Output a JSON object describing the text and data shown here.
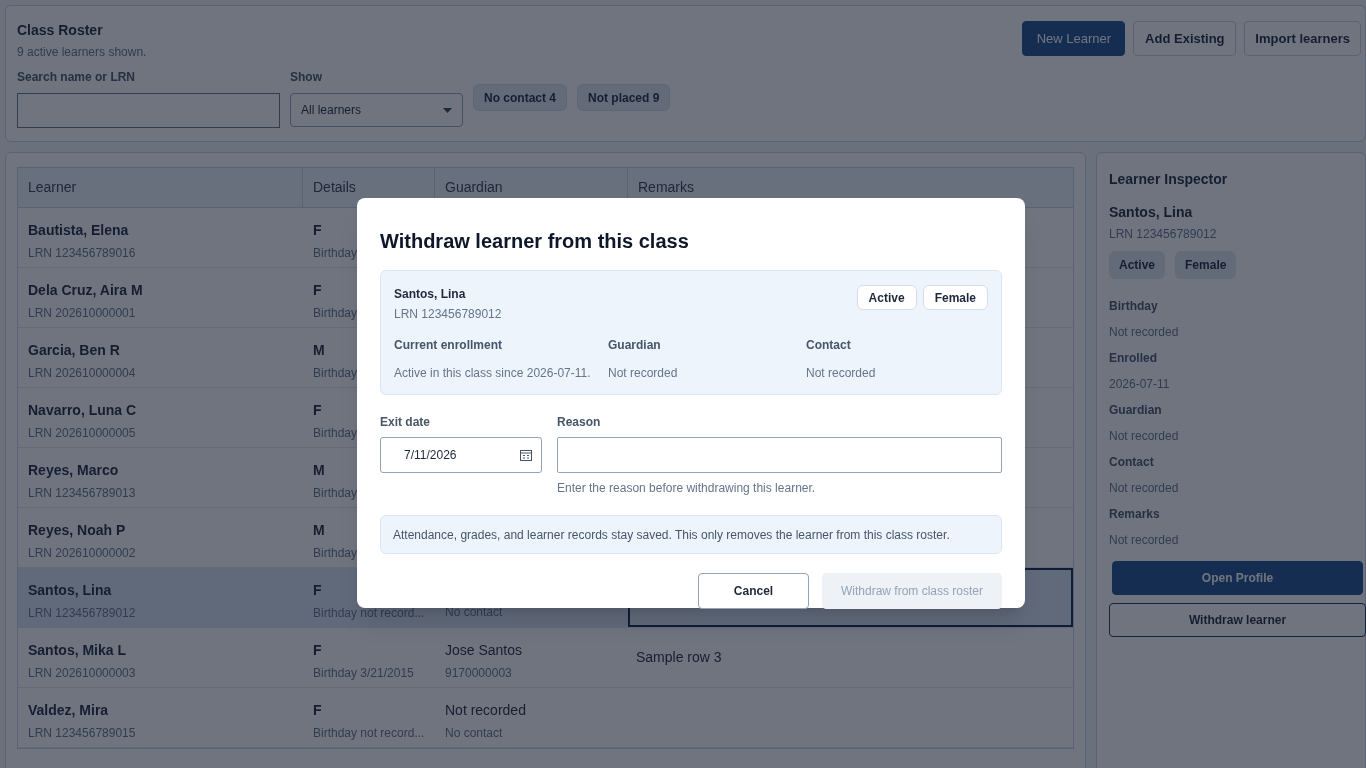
{
  "header": {
    "title": "Class Roster",
    "subtitle": "9 active learners shown.",
    "actions": [
      {
        "label": "New Learner",
        "kind": "primary"
      },
      {
        "label": "Add Existing",
        "kind": "secondary"
      },
      {
        "label": "Import learners",
        "kind": "secondary"
      }
    ]
  },
  "filters": {
    "search": {
      "label": "Search name or LRN"
    },
    "show": {
      "label": "Show",
      "value": "All learners"
    },
    "chips": [
      "No contact 4",
      "Not placed 9"
    ]
  },
  "table": {
    "columns": [
      "Learner",
      "Details",
      "Guardian",
      "Remarks"
    ],
    "rows": [
      {
        "name": "Bautista, Elena",
        "lrn": "LRN 123456789016",
        "sex": "F",
        "birthday": "Birthday",
        "selected": false,
        "editing": false
      },
      {
        "name": "Dela Cruz, Aira M",
        "lrn": "LRN 202610000001",
        "sex": "F",
        "birthday": "Birthday",
        "selected": false,
        "editing": false
      },
      {
        "name": "Garcia, Ben R",
        "lrn": "LRN 202610000004",
        "sex": "M",
        "birthday": "Birthday",
        "selected": false,
        "editing": false
      },
      {
        "name": "Navarro, Luna C",
        "lrn": "LRN 202610000005",
        "sex": "F",
        "birthday": "Birthday",
        "selected": false,
        "editing": false
      },
      {
        "name": "Reyes, Marco",
        "lrn": "LRN 123456789013",
        "sex": "M",
        "birthday": "Birthday",
        "selected": false,
        "editing": false
      },
      {
        "name": "Reyes, Noah P",
        "lrn": "LRN 202610000002",
        "sex": "M",
        "birthday": "Birthday",
        "selected": false,
        "editing": false
      },
      {
        "name": "Santos, Lina",
        "lrn": "LRN 123456789012",
        "sex": "F",
        "birthday": "Birthday not record...",
        "contact": "No contact",
        "selected": true,
        "editing": true
      },
      {
        "name": "Santos, Mika L",
        "lrn": "LRN 202610000003",
        "sex": "F",
        "birthday": "Birthday 3/21/2015",
        "guardian": "Jose Santos",
        "contact": "9170000003",
        "remarks": "Sample row 3",
        "selected": false,
        "editing": false
      },
      {
        "name": "Valdez, Mira",
        "lrn": "LRN 123456789015",
        "sex": "F",
        "birthday": "Birthday not record...",
        "guardian": "Not recorded",
        "contact": "No contact",
        "selected": false,
        "editing": false
      }
    ]
  },
  "inspector": {
    "title": "Learner Inspector",
    "name": "Santos, Lina",
    "lrn": "LRN 123456789012",
    "tags": [
      "Active",
      "Female"
    ],
    "fields": [
      {
        "label": "Birthday",
        "value": "Not recorded"
      },
      {
        "label": "Enrolled",
        "value": "2026-07-11"
      },
      {
        "label": "Guardian",
        "value": "Not recorded"
      },
      {
        "label": "Contact",
        "value": "Not recorded"
      },
      {
        "label": "Remarks",
        "value": "Not recorded"
      }
    ],
    "buttons": [
      {
        "label": "Open Profile",
        "kind": "primary"
      },
      {
        "label": "Withdraw learner",
        "kind": "outline"
      }
    ]
  },
  "dialog": {
    "title": "Withdraw learner from this class",
    "learner": {
      "name": "Santos, Lina",
      "lrn": "LRN 123456789012",
      "tags": [
        "Active",
        "Female"
      ]
    },
    "info": [
      {
        "label": "Current enrollment",
        "value": "Active in this class since 2026-07-11."
      },
      {
        "label": "Guardian",
        "value": "Not recorded"
      },
      {
        "label": "Contact",
        "value": "Not recorded"
      }
    ],
    "exit_date": {
      "label": "Exit date",
      "value": "7/11/2026"
    },
    "reason": {
      "label": "Reason",
      "hint": "Enter the reason before withdrawing this learner."
    },
    "note": "Attendance, grades, and learner records stay saved. This only removes the learner from this class roster.",
    "buttons": [
      {
        "label": "Cancel",
        "disabled": false
      },
      {
        "label": "Withdraw from class roster",
        "disabled": true
      }
    ]
  }
}
